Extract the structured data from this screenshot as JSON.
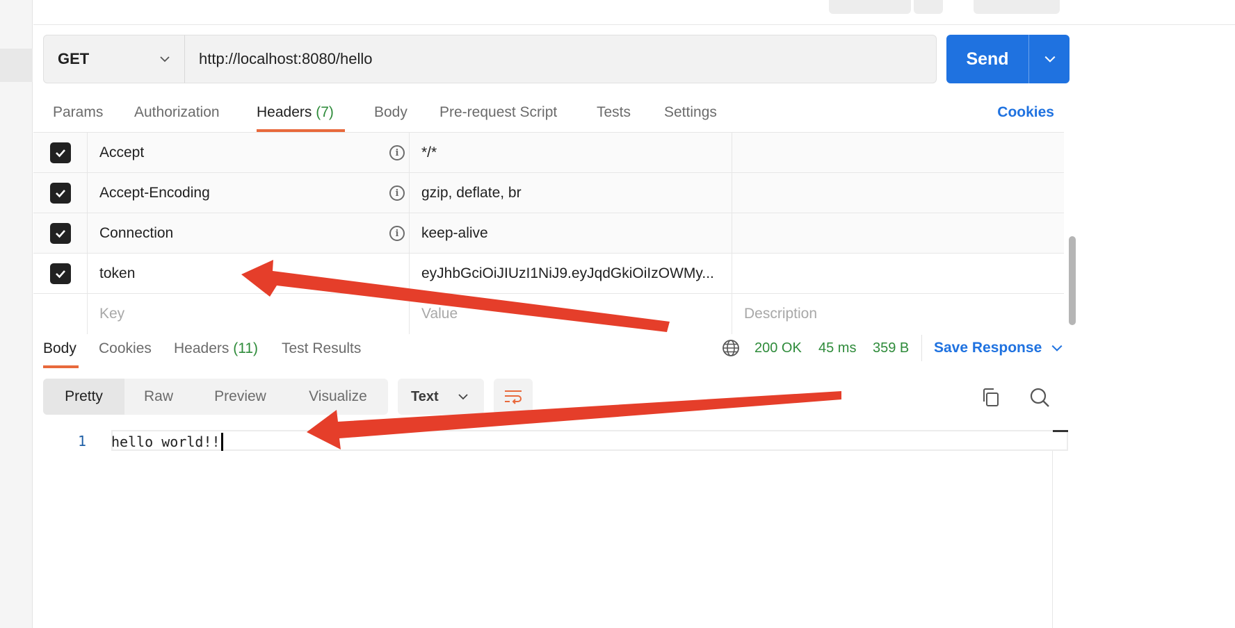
{
  "request": {
    "method": "GET",
    "url": "http://localhost:8080/hello",
    "send_label": "Send"
  },
  "request_tabs": {
    "params": "Params",
    "authorization": "Authorization",
    "headers": "Headers",
    "headers_count": "(7)",
    "body": "Body",
    "prerequest": "Pre-request Script",
    "tests": "Tests",
    "settings": "Settings",
    "cookies": "Cookies"
  },
  "headers_table": {
    "rows": [
      {
        "key": "Accept",
        "value": "*/*",
        "description": "",
        "checked": true
      },
      {
        "key": "Accept-Encoding",
        "value": "gzip, deflate, br",
        "description": "",
        "checked": true
      },
      {
        "key": "Connection",
        "value": "keep-alive",
        "description": "",
        "checked": true
      },
      {
        "key": "token",
        "value": "eyJhbGciOiJIUzI1NiJ9.eyJqdGkiOiIzOWMy...",
        "description": "",
        "checked": true
      }
    ],
    "placeholder": {
      "key": "Key",
      "value": "Value",
      "description": "Description"
    }
  },
  "response_tabs": {
    "body": "Body",
    "cookies": "Cookies",
    "headers": "Headers",
    "headers_count": "(11)",
    "test_results": "Test Results"
  },
  "response_status": {
    "status": "200 OK",
    "time": "45 ms",
    "size": "359 B",
    "save_label": "Save Response"
  },
  "body_toolbar": {
    "views": [
      "Pretty",
      "Raw",
      "Preview",
      "Visualize"
    ],
    "format": "Text"
  },
  "response_body": {
    "line_number": "1",
    "text": "hello world!!"
  },
  "colors": {
    "accent": "#e8693c",
    "primary": "#1f72e0",
    "success": "#2e8b3a",
    "annotation_arrow": "#e53e2a"
  }
}
